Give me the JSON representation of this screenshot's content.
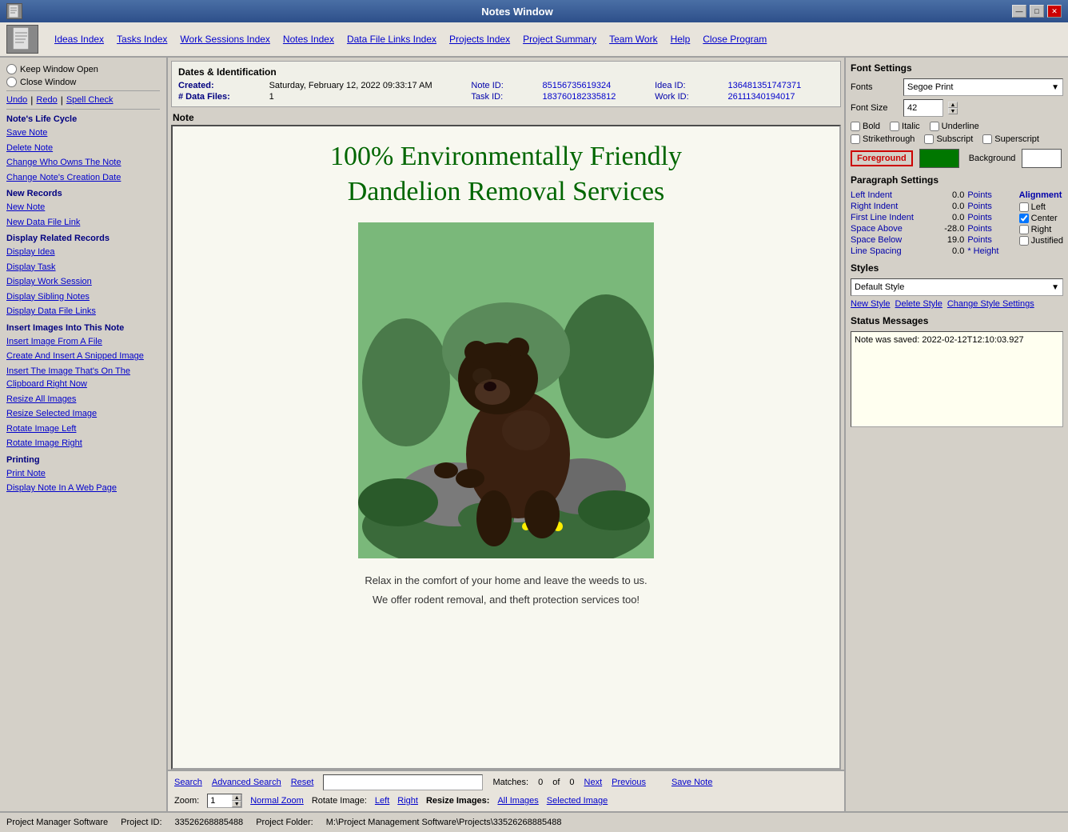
{
  "window": {
    "title": "Notes Window",
    "titlebar_icon": "📄"
  },
  "titlebar_controls": {
    "minimize": "—",
    "maximize": "□",
    "close": "✕"
  },
  "menu": {
    "logo": "📄",
    "items": [
      "Ideas Index",
      "Tasks Index",
      "Work Sessions Index",
      "Notes Index",
      "Data File Links Index",
      "Projects Index",
      "Project Summary",
      "Team Work",
      "Help",
      "Close Program"
    ]
  },
  "sidebar": {
    "radio1": "Keep Window Open",
    "radio2": "Close Window",
    "actions": [
      "Undo",
      "Redo",
      "Spell Check"
    ],
    "sections": [
      {
        "title": "Note's Life Cycle",
        "links": [
          "Save Note",
          "Delete Note",
          "Change Who Owns The Note",
          "Change Note's Creation Date"
        ]
      },
      {
        "title": "New Records",
        "links": [
          "New Note",
          "New Data File Link"
        ]
      },
      {
        "title": "Display Related Records",
        "links": [
          "Display Idea",
          "Display Task",
          "Display Work Session",
          "Display Sibling Notes",
          "Display Data File Links"
        ]
      },
      {
        "title": "Insert Images Into This Note",
        "links": [
          "Insert Image From A File",
          "Create And Insert A Snipped Image",
          "Insert The Image That's On The Clipboard Right Now",
          "Resize All Images",
          "Resize Selected Image",
          "Rotate Image Left",
          "Rotate Image Right"
        ]
      },
      {
        "title": "Printing",
        "links": [
          "Print Note",
          "Display Note In A Web Page"
        ]
      }
    ]
  },
  "dates": {
    "section_title": "Dates & Identification",
    "created_label": "Created:",
    "created_value": "Saturday, February 12, 2022  09:33:17 AM",
    "data_files_label": "# Data Files:",
    "data_files_value": "1",
    "note_id_label": "Note ID:",
    "note_id_value": "85156735619324",
    "idea_id_label": "Idea ID:",
    "idea_id_value": "136481351747371",
    "task_id_label": "Task ID:",
    "task_id_value": "183760182335812",
    "work_id_label": "Work ID:",
    "work_id_value": "26111340194017"
  },
  "note": {
    "section_title": "Note",
    "title_line1": "100% Environmentally Friendly",
    "title_line2": "Dandelion Removal Services",
    "body_line1": "Relax in the comfort of your home and leave the weeds to us.",
    "body_line2": "We offer rodent removal, and theft protection services too!"
  },
  "bottom_toolbar": {
    "search_label": "Search",
    "advanced_search_label": "Advanced Search",
    "reset_label": "Reset",
    "matches_label": "Matches:",
    "matches_count": "0",
    "of_label": "of",
    "of_count": "0",
    "next_label": "Next",
    "previous_label": "Previous",
    "save_note_label": "Save Note",
    "zoom_label": "Zoom:",
    "zoom_value": "1",
    "normal_zoom_label": "Normal Zoom",
    "rotate_image_label": "Rotate Image:",
    "left_label": "Left",
    "right_label": "Right",
    "resize_images_label": "Resize Images:",
    "all_images_label": "All Images",
    "selected_image_label": "Selected Image"
  },
  "font_settings": {
    "section_title": "Font Settings",
    "font_label": "Fonts",
    "font_value": "Segoe Print",
    "size_label": "Font Size",
    "size_value": "42",
    "bold_label": "Bold",
    "italic_label": "Italic",
    "underline_label": "Underline",
    "strikethrough_label": "Strikethrough",
    "subscript_label": "Subscript",
    "superscript_label": "Superscript",
    "foreground_label": "Foreground",
    "background_label": "Background",
    "fg_color": "#007700",
    "bg_color": "#ffffff"
  },
  "paragraph_settings": {
    "section_title": "Paragraph Settings",
    "left_indent_label": "Left Indent",
    "left_indent_value": "0.0",
    "right_indent_label": "Right Indent",
    "right_indent_value": "0.0",
    "first_line_label": "First Line Indent",
    "first_line_value": "0.0",
    "space_above_label": "Space Above",
    "space_above_value": "-28.0",
    "space_below_label": "Space Below",
    "space_below_value": "19.0",
    "line_spacing_label": "Line Spacing",
    "line_spacing_value": "0.0",
    "points": "Points",
    "height": "* Height",
    "alignment_label": "Alignment",
    "left_align": "Left",
    "center_align": "Center",
    "right_align": "Right",
    "justified_align": "Justified"
  },
  "styles": {
    "section_title": "Styles",
    "default_style": "Default Style",
    "new_style_btn": "New Style",
    "delete_style_btn": "Delete Style",
    "change_style_btn": "Change Style Settings"
  },
  "status_messages": {
    "section_title": "Status Messages",
    "message": "Note was saved:  2022-02-12T12:10:03.927"
  },
  "status_bar": {
    "app_name": "Project Manager Software",
    "project_id_label": "Project ID:",
    "project_id": "33526268885488",
    "folder_label": "Project Folder:",
    "folder_path": "M:\\Project Management Software\\Projects\\33526268885488"
  }
}
